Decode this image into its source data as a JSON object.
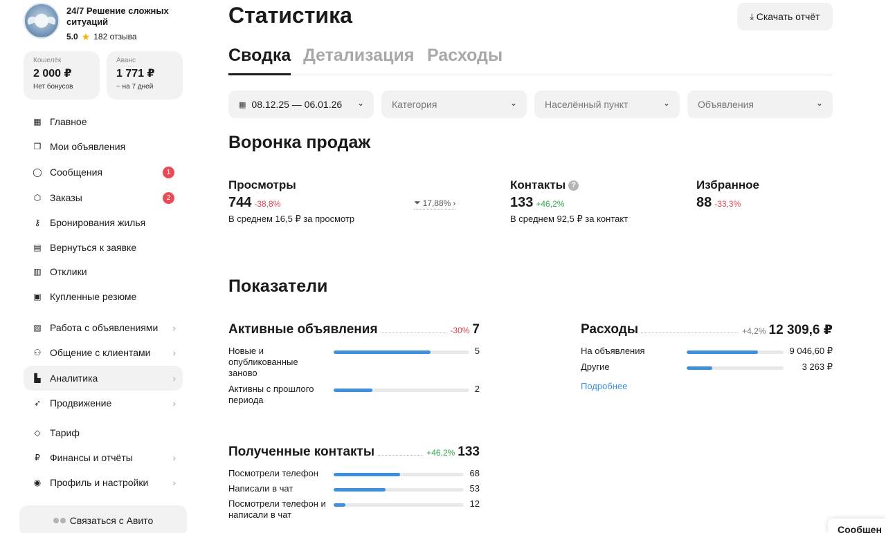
{
  "profile": {
    "name": "24/7 Решение сложных ситуаций",
    "rating": "5.0",
    "reviews": "182 отзыва"
  },
  "wallet": {
    "label": "Кошелёк",
    "value": "2 000 ₽",
    "sub": "Нет бонусов"
  },
  "advance": {
    "label": "Аванс",
    "value": "1 771 ₽",
    "sub": "~ на 7 дней"
  },
  "nav": [
    {
      "label": "Главное",
      "icon": "grid-icon"
    },
    {
      "label": "Мои объявления",
      "icon": "copy-icon"
    },
    {
      "label": "Сообщения",
      "icon": "chat-icon",
      "badge": "1"
    },
    {
      "label": "Заказы",
      "icon": "box-icon",
      "badge": "2"
    },
    {
      "label": "Бронирования жилья",
      "icon": "key-icon"
    },
    {
      "label": "Вернуться к заявке",
      "icon": "doc-icon"
    },
    {
      "label": "Отклики",
      "icon": "doc-check-icon"
    },
    {
      "label": "Купленные резюме",
      "icon": "resume-icon"
    },
    {
      "label": "Работа с объявлениями",
      "icon": "stack-icon"
    },
    {
      "label": "Общение с клиентами",
      "icon": "people-icon"
    },
    {
      "label": "Аналитика",
      "icon": "chart-icon"
    },
    {
      "label": "Продвижение",
      "icon": "rocket-icon"
    },
    {
      "label": "Тариф",
      "icon": "diamond-icon"
    },
    {
      "label": "Финансы и отчёты",
      "icon": "ruble-icon"
    },
    {
      "label": "Профиль и настройки",
      "icon": "user-circle-icon"
    }
  ],
  "contact_avito": "Связаться с Авито",
  "page_title": "Статистика",
  "download_label": "Скачать отчёт",
  "tabs": [
    "Сводка",
    "Детализация",
    "Расходы"
  ],
  "filters": {
    "date": "08.12.25 — 06.01.26",
    "category": "Категория",
    "city": "Населённый пункт",
    "ads": "Объявления"
  },
  "funnel": {
    "title": "Воронка продаж",
    "views": {
      "label": "Просмотры",
      "value": "744",
      "change": "-38,8%",
      "avg": "В среднем 16,5 ₽ за просмотр"
    },
    "conversion": "17,88%",
    "contacts": {
      "label": "Контакты",
      "value": "133",
      "change": "+46,2%",
      "avg": "В среднем 92,5 ₽ за контакт"
    },
    "favorites": {
      "label": "Избранное",
      "value": "88",
      "change": "-33,3%"
    }
  },
  "metrics": {
    "title": "Показатели",
    "active": {
      "label": "Активные объявления",
      "change": "-30%",
      "total": "7",
      "rows": [
        {
          "label": "Новые и опубликованные заново",
          "value": "5",
          "fraction": 0.714
        },
        {
          "label": "Активны с прошлого периода",
          "value": "2",
          "fraction": 0.286
        }
      ]
    },
    "expenses": {
      "label": "Расходы",
      "change": "+4,2%",
      "total": "12 309,6 ₽",
      "rows": [
        {
          "label": "На объявления",
          "value": "9 046,60 ₽",
          "fraction": 0.735
        },
        {
          "label": "Другие",
          "value": "3 263 ₽",
          "fraction": 0.265
        }
      ],
      "more": "Подробнее"
    },
    "contacts": {
      "label": "Полученные контакты",
      "change": "+46,2%",
      "total": "133",
      "rows": [
        {
          "label": "Посмотрели телефон",
          "value": "68",
          "fraction": 0.511
        },
        {
          "label": "Написали в чат",
          "value": "53",
          "fraction": 0.398
        },
        {
          "label": "Посмотрели телефон и написали в чат",
          "value": "12",
          "fraction": 0.09
        }
      ]
    }
  },
  "corner_chip": "Сообщен",
  "colors": {
    "accent": "#3d8fe0",
    "negative": "#e0444f",
    "positive": "#2fa84f",
    "badge": "#ea4c57"
  }
}
